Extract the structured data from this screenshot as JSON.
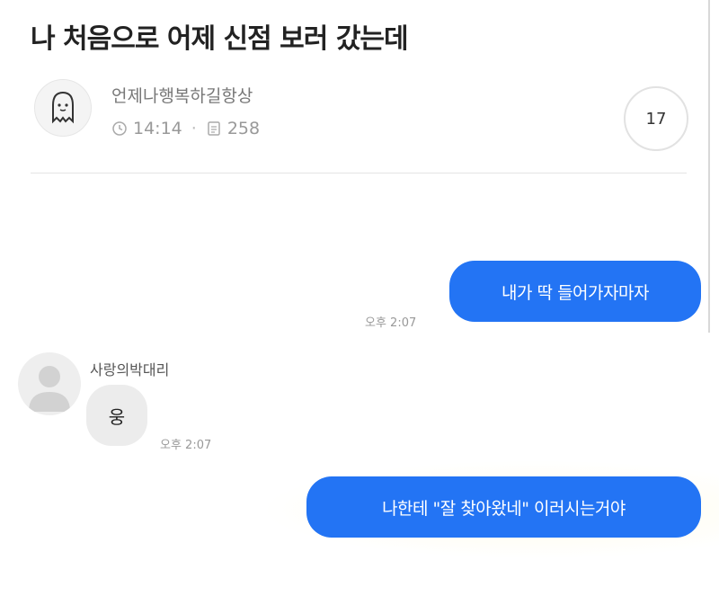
{
  "post": {
    "title": "나 처음으로 어제 신점 보러 갔는데",
    "author": "언제나행복하길항상",
    "time": "14:14",
    "views": "258",
    "comment_count": "17"
  },
  "chat": {
    "messages": [
      {
        "direction": "outgoing",
        "text": "내가 딱 들어가자마자",
        "time": "오후 2:07"
      },
      {
        "direction": "incoming",
        "sender": "사랑의박대리",
        "text": "웅",
        "time": "오후 2:07"
      },
      {
        "direction": "outgoing",
        "text": "나한테 \"잘 찾아왔네\" 이러시는거야"
      }
    ]
  },
  "colors": {
    "outgoing_bubble": "#2374f4",
    "incoming_bubble": "#ececec",
    "meta_text": "#999999"
  }
}
